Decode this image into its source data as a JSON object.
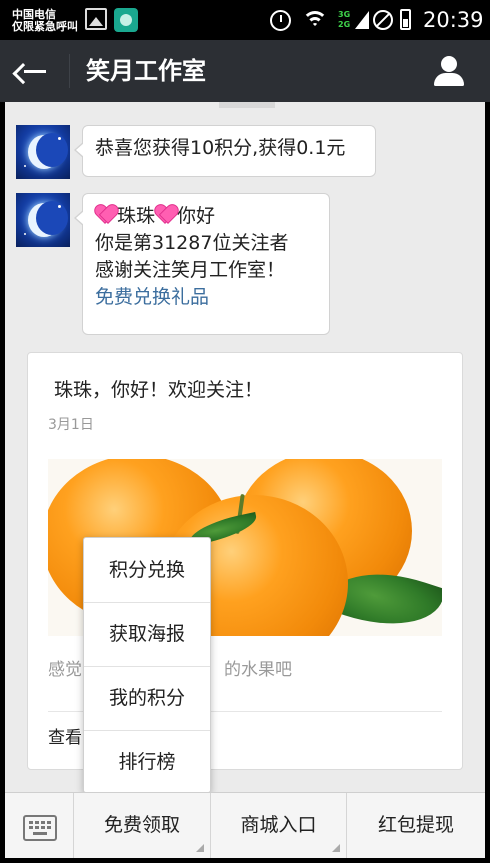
{
  "status_bar": {
    "carrier_line1": "中国电信",
    "carrier_line2": "仅限紧急呼叫",
    "network_labels": [
      "3G",
      "2G"
    ],
    "time": "20:39",
    "icons": [
      "gallery-icon",
      "app-icon",
      "alarm-icon",
      "wifi-icon",
      "signal-icon",
      "no-sim-icon",
      "battery-icon"
    ]
  },
  "header": {
    "title": "笑月工作室",
    "icons": [
      "back-arrow-icon",
      "profile-icon"
    ]
  },
  "messages": [
    {
      "lines": [
        "恭喜您获得10积分,获得0.1元"
      ]
    },
    {
      "greeting_name": "珠珠",
      "greeting_suffix": "你好",
      "lines": [
        "你是第31287位关注者",
        "感谢关注笑月工作室！"
      ],
      "link": "免费兑换礼品"
    }
  ],
  "article": {
    "title": "珠珠，你好！欢迎关注！",
    "date": "3月1日",
    "excerpt_left": "感觉",
    "excerpt_right": "的水果吧",
    "read_more": "查看"
  },
  "popup_menu": {
    "items": [
      "积分兑换",
      "获取海报",
      "我的积分",
      "排行榜"
    ]
  },
  "bottom_menu": {
    "items": [
      "免费领取",
      "商城入口",
      "红包提现"
    ],
    "icons": [
      "keyboard-icon"
    ]
  },
  "colors": {
    "title_bar": "#2c2f34",
    "chat_background": "#ebebeb",
    "link": "#3c6e9e",
    "heart": "#ff5fb2"
  }
}
